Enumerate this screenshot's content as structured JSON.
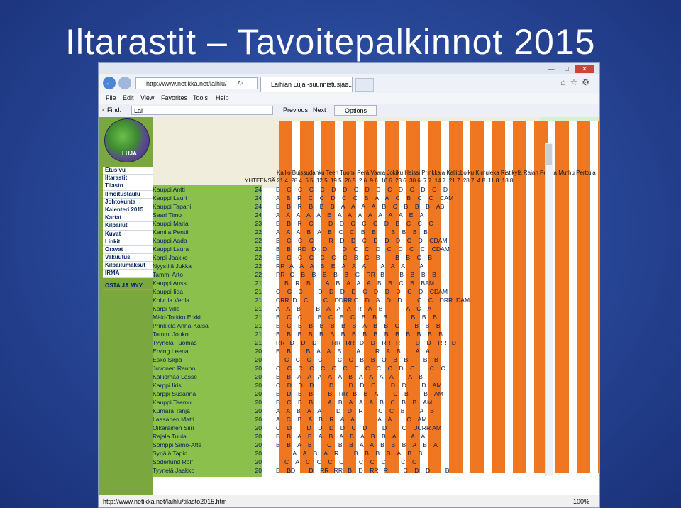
{
  "slide": {
    "title": "Iltarastit – Tavoitepalkinnot 2015"
  },
  "browser": {
    "url": "http://www.netikka.net/laihlu/",
    "tab_title": "Laihian Luja -suunnistusjao...",
    "menu": [
      "File",
      "Edit",
      "View",
      "Favorites",
      "Tools",
      "Help"
    ],
    "find_label": "Find:",
    "find_value": "Lai",
    "previous_label": "Previous",
    "next_label": "Next",
    "options_label": "Options",
    "status_url": "http://www.netikka.net/laihlu/tilasto2015.htm",
    "zoom": "100%"
  },
  "sidebar": {
    "logo_text": "LUJA",
    "items": [
      "Etusivu",
      "Iltarastit",
      "Tilasto",
      "Ilmoitustaulu",
      "Johtokunta",
      "Kalenteri 2015",
      "Kartat",
      "Kilpailut",
      "Kuvat",
      "Linkit",
      "Oravat",
      "Vakuutus",
      "Kilpailumaksut",
      "IRMA"
    ],
    "buy_sell": "OSTA JA MYY"
  },
  "table": {
    "header_places": "Kallio Bujssudanku Teeri Tuomi Perä Vaara Jokiku Haissi Prinkkala Kalliobolku Kirnuleka Ristikylä Rajan Pelkka Murhu Perttula",
    "header_dates": "YHTEENSÄ 21.4. 28.4. 5.5. 12.5. 19.5. 26.5. 2.6. 9.6. 16.6. 23.6. 30.6. 7.7. 14.7. 21.7. 28.7. 4.8. 11.8. 18.8.",
    "rows": [
      {
        "name": "Kauppi Antti",
        "points": "24",
        "marks": "B    C    C    C    C    D    D    C    D    D    C    D    C    D    C    D"
      },
      {
        "name": "Kauppi Lauri",
        "points": "24",
        "marks": "A    B    R    C    C    D    C    C    B    A    A    C    B    C    C    CAM"
      },
      {
        "name": "Kauppi Tapani",
        "points": "24",
        "marks": "B    B    R    B    B    B    A    A    A    A    B    C    B    B    B    AB"
      },
      {
        "name": "Saari Timo",
        "points": "24",
        "marks": "A    A    A    A    A    E    A    A    A    A    A    A    A    E    A"
      },
      {
        "name": "Kauppi Marja",
        "points": "23",
        "marks": "B    B    R    C         D    D    C    C    C    D    B    C    C    C"
      },
      {
        "name": "Kamila Pentti",
        "points": "22",
        "marks": "A    A    A    B    A    B    C    C    B    B         B    B    B    B"
      },
      {
        "name": "Kauppi Aada",
        "points": "22",
        "marks": "B    C    C    C         R    D    D    C    D    D    D    C    D    CDAM"
      },
      {
        "name": "Kauppi Laura",
        "points": "22",
        "marks": "B    B    RD   D    D         D    C    C    D    C    D    C    C    CDAM"
      },
      {
        "name": "Korpi Jaakko",
        "points": "22",
        "marks": "B    C    C    C    C    C    C    B    C    B         B    B    C    B"
      },
      {
        "name": "Nyystilä Jukka",
        "points": "22",
        "marks": "RR   A    A    A    B    E    A    A    A         A    A    A         A"
      },
      {
        "name": "Tammi Arto",
        "points": "22",
        "marks": "RR   C    B    B    B    B    B    C    RR   B         B    B    B    B"
      },
      {
        "name": "Kauppi Anssi",
        "points": "21",
        "marks": "     B    R    B         A    B    A    A    A    B    B    C    B    BAM"
      },
      {
        "name": "Kauppi Iida",
        "points": "21",
        "marks": "C    C    C         D    D    D    D    C    D    D    D    C    D    CDAM"
      },
      {
        "name": "Koivula Venla",
        "points": "21",
        "marks": "CRR  D    C         C    DDRR C    D    A    D    D         C    C    DRR  DAM"
      },
      {
        "name": "Korpi Ville",
        "points": "21",
        "marks": "A    A    B         B    A    A    A    R    A    B              A    C    A"
      },
      {
        "name": "Mäki-Torkko Erkki",
        "points": "21",
        "marks": "B    C    C         B    C    B    C    B    B    B              B    B    B"
      },
      {
        "name": "Prinkkilä Anna-Kaisa",
        "points": "21",
        "marks": "B    C    B    B    B    B    B    B    A    B    B    C         B    B    B"
      },
      {
        "name": "Tammi Jouko",
        "points": "21",
        "marks": "B    B    B    B    B    B    B    B    B    B    B    B    B    B    B    B"
      },
      {
        "name": "Tyynelä Tuomas",
        "points": "21",
        "marks": "RR   D    D    D         RR   RR   D    D    RR   R         D    D    RR   D"
      },
      {
        "name": "Erving Leena",
        "points": "20",
        "marks": "B    B         B    A    A    B         A         R    A    B         A    A"
      },
      {
        "name": "Esko Sirpa",
        "points": "20",
        "marks": "     C    C    C    C         C    C    B    B    O    B    B         B    B"
      },
      {
        "name": "Juvonen Rauno",
        "points": "20",
        "marks": "C    C    C    C    C    C    C    C    C    C    C    D    C         C    C"
      },
      {
        "name": "Kalliomaa Lasse",
        "points": "20",
        "marks": "B    B    A    A    A    A    A    B    A    A    A    A         A    B"
      },
      {
        "name": "Karppi Iiris",
        "points": "20",
        "marks": "C    D    D    D         D         D    D    C         D    D         D    AM"
      },
      {
        "name": "Karppi Susanna",
        "points": "20",
        "marks": "B    D    B    B         B    RR   B    B    A         C    B         B    AM"
      },
      {
        "name": "Kauppi Teemu",
        "points": "20",
        "marks": "B    C    B    B         A    B    A    A    A    B    C    B    B    AM"
      },
      {
        "name": "Kumara Tanja",
        "points": "20",
        "marks": "A    A    B    A    A         D    D    R         C    C    B         A    B"
      },
      {
        "name": "Laasanen Matti",
        "points": "20",
        "marks": "A    C    B    A    B    R    A    A              A    A         C    AM"
      },
      {
        "name": "Oikarainen Siiri",
        "points": "20",
        "marks": "C    D         D    D    D    D    C    D         D         C    DCRR AM"
      },
      {
        "name": "Rajala Tuula",
        "points": "20",
        "marks": "B    B    A    B    A    B    A    B    A    B    B    A         A    A"
      },
      {
        "name": "Somppi Simo-Atte",
        "points": "20",
        "marks": "B    B    A    B         C    B    B    A    A    B    B    B    A    B    A"
      },
      {
        "name": "Syrjälä Tapio",
        "points": "20",
        "marks": "          A    A    B    A    R         B    B    B    B    A    B    B"
      },
      {
        "name": "Söderlund Rolf",
        "points": "20",
        "marks": "     C    A    C    C    C    C         C    C    C         C    C"
      },
      {
        "name": "Tyynelä Jaakko",
        "points": "20",
        "marks": "B    BD        D    RR   RR   B    D    RR   R         C    D    D         B"
      }
    ]
  }
}
